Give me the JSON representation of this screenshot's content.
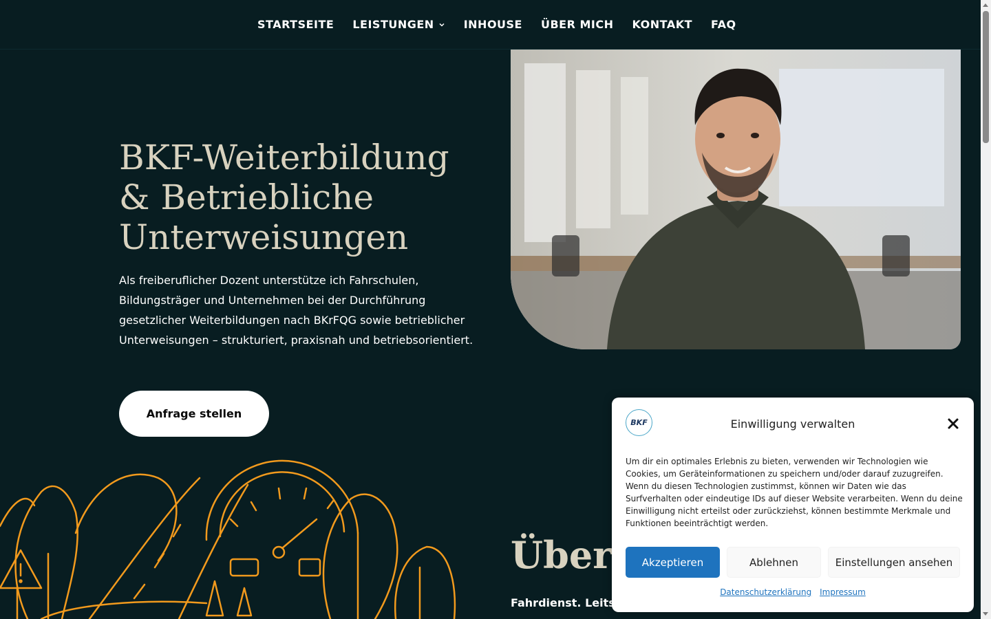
{
  "nav": {
    "items": [
      {
        "label": "STARTSEITE",
        "has_dropdown": false
      },
      {
        "label": "LEISTUNGEN",
        "has_dropdown": true
      },
      {
        "label": "INHOUSE",
        "has_dropdown": false
      },
      {
        "label": "ÜBER MICH",
        "has_dropdown": false
      },
      {
        "label": "KONTAKT",
        "has_dropdown": false
      },
      {
        "label": "FAQ",
        "has_dropdown": false
      }
    ]
  },
  "hero": {
    "title_line1": "BKF-Weiterbildung",
    "title_line2": "& Betriebliche",
    "title_line3": "Unterweisungen",
    "text": "Als freiberuflicher Dozent unterstütze ich Fahrschulen, Bildungsträger und Unternehmen bei der Durchführung gesetzlicher Weiterbildungen nach BKrFQG sowie betrieblicher Unterweisungen – strukturiert, praxisnah und betriebsorientiert.",
    "cta_label": "Anfrage stellen"
  },
  "about": {
    "heading": "Über",
    "subline": "Fahrdienst. Leits"
  },
  "cookie": {
    "logo_text": "BKF",
    "title": "Einwilligung verwalten",
    "message": "Um dir ein optimales Erlebnis zu bieten, verwenden wir Technologien wie Cookies, um Geräteinformationen zu speichern und/oder darauf zuzugreifen. Wenn du diesen Technologien zustimmst, können wir Daten wie das Surfverhalten oder eindeutige IDs auf dieser Website verarbeiten. Wenn du deine Einwilligung nicht erteilst oder zurückziehst, können bestimmte Merkmale und Funktionen beeinträchtigt werden.",
    "accept_label": "Akzeptieren",
    "deny_label": "Ablehnen",
    "prefs_label": "Einstellungen ansehen",
    "privacy_link": "Datenschutzerklärung",
    "imprint_link": "Impressum"
  },
  "colors": {
    "background": "#081d21",
    "heading": "#d8d2bf",
    "illustration": "#f29a1d",
    "accept_button": "#1e73be"
  }
}
